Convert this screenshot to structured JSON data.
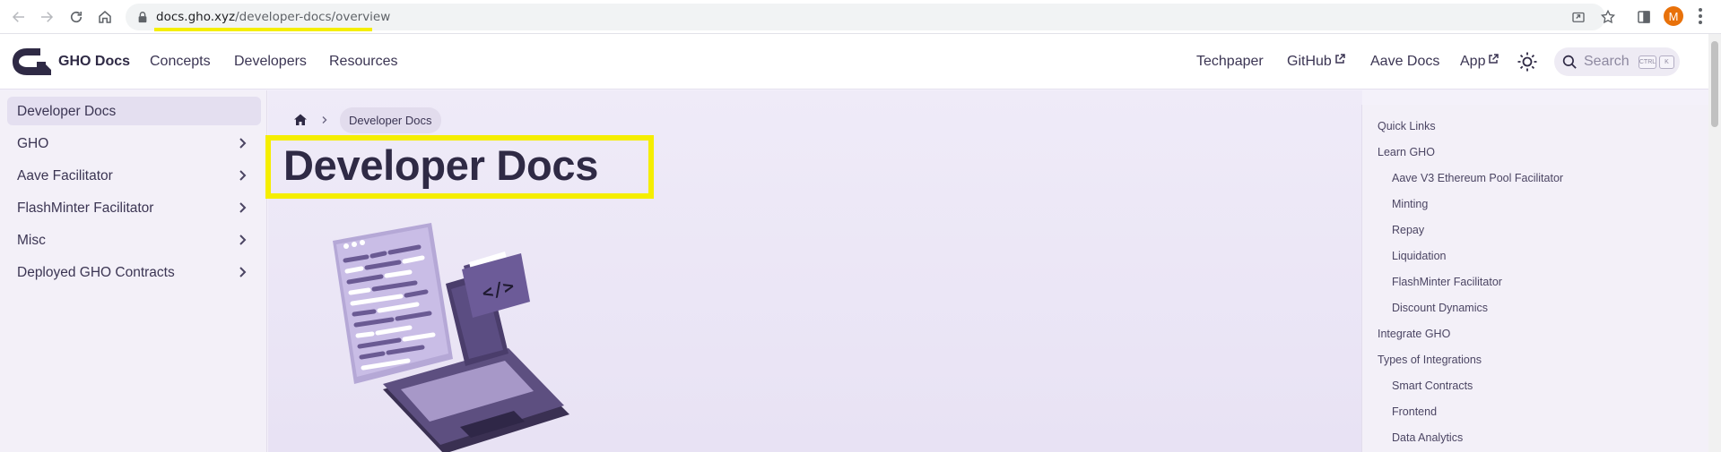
{
  "browser": {
    "url_host": "docs.gho.xyz",
    "url_path": "/developer-docs/overview",
    "profile_initial": "M",
    "icons": [
      "back-icon",
      "forward-icon",
      "reload-icon",
      "home-icon",
      "lock-icon",
      "share-icon",
      "star-icon",
      "sidepanel-icon",
      "menu-icon"
    ]
  },
  "navbar": {
    "site_name": "GHO Docs",
    "links": [
      "Concepts",
      "Developers",
      "Resources"
    ],
    "right_links": {
      "techpaper": "Techpaper",
      "github": "GitHub",
      "aave_docs": "Aave Docs",
      "app": "App"
    },
    "search_placeholder": "Search",
    "kbd_ctrl": "CTRL",
    "kbd_k": "K"
  },
  "sidebar": {
    "items": [
      {
        "label": "Developer Docs",
        "active": true,
        "chevron": false
      },
      {
        "label": "GHO",
        "active": false,
        "chevron": true
      },
      {
        "label": "Aave Facilitator",
        "active": false,
        "chevron": true
      },
      {
        "label": "FlashMinter Facilitator",
        "active": false,
        "chevron": true
      },
      {
        "label": "Misc",
        "active": false,
        "chevron": true
      },
      {
        "label": "Deployed GHO Contracts",
        "active": false,
        "chevron": true
      }
    ]
  },
  "main": {
    "breadcrumb": "Developer Docs",
    "title": "Developer Docs",
    "illustration_code_glyph": "</>"
  },
  "toc": {
    "items": [
      {
        "label": "Quick Links",
        "level": 1
      },
      {
        "label": "Learn GHO",
        "level": 1
      },
      {
        "label": "Aave V3 Ethereum Pool Facilitator",
        "level": 2
      },
      {
        "label": "Minting",
        "level": 2
      },
      {
        "label": "Repay",
        "level": 2
      },
      {
        "label": "Liquidation",
        "level": 2
      },
      {
        "label": "FlashMinter Facilitator",
        "level": 2
      },
      {
        "label": "Discount Dynamics",
        "level": 2
      },
      {
        "label": "Integrate GHO",
        "level": 1
      },
      {
        "label": "Types of Integrations",
        "level": 1
      },
      {
        "label": "Smart Contracts",
        "level": 2
      },
      {
        "label": "Frontend",
        "level": 2
      },
      {
        "label": "Data Analytics",
        "level": 2
      }
    ]
  },
  "colors": {
    "accent_highlight": "#f5ee00",
    "text_primary": "#2f2a45",
    "sidebar_active_bg": "#e4dff0",
    "profile_bg": "#e8710a"
  }
}
